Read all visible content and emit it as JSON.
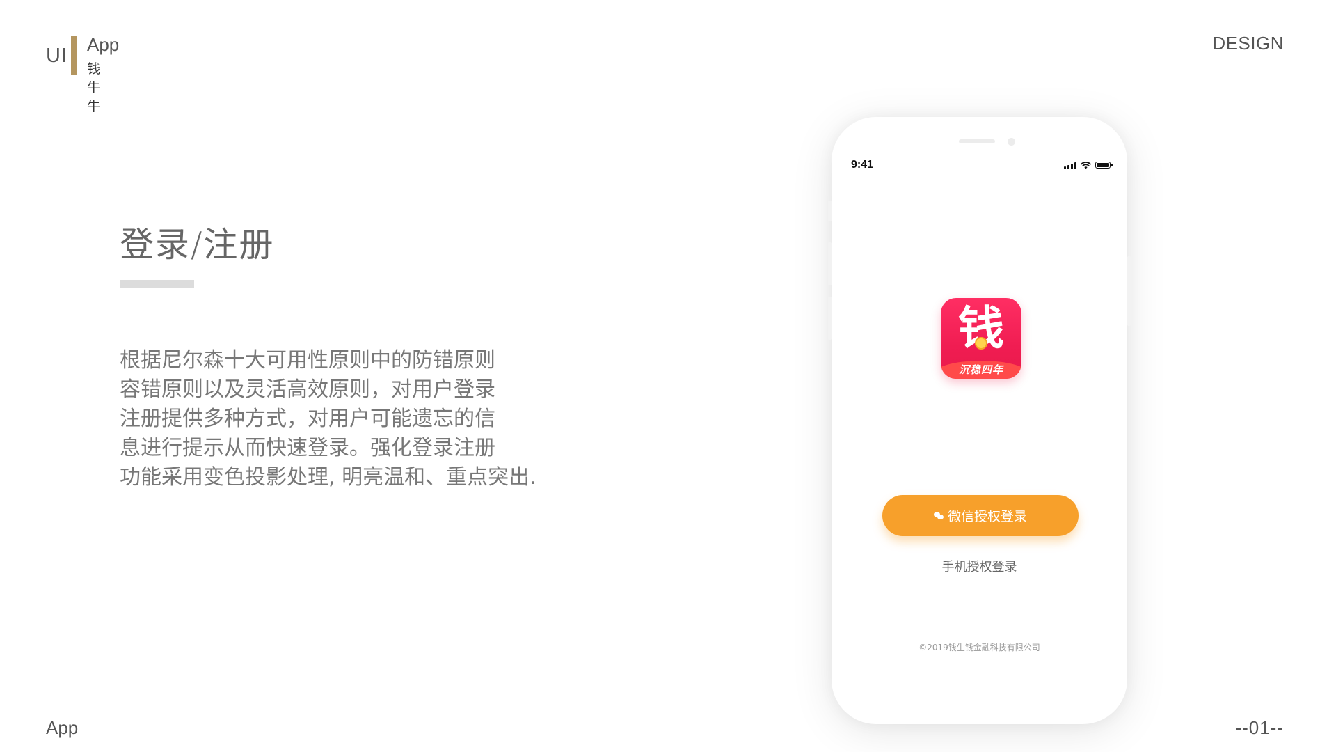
{
  "header": {
    "ui_label": "UI",
    "app_label": "App",
    "app_name": "钱牛牛",
    "design_label": "DESIGN"
  },
  "main": {
    "title": "登录/注册",
    "description_lines": [
      "根据尼尔森十大可用性原则中的防错原则",
      "容错原则以及灵活高效原则，对用户登录",
      "注册提供多种方式，对用户可能遗忘的信",
      "息进行提示从而快速登录。强化登录注册",
      "功能采用变色投影处理, 明亮温和、重点突出."
    ]
  },
  "phone": {
    "status_time": "9:41",
    "app_icon": {
      "glyph": "钱",
      "tagline": "沉稳四年"
    },
    "wechat_login_label": "微信授权登录",
    "phone_login_label": "手机授权登录",
    "copyright": "©2019钱生钱金融科技有限公司",
    "accent_color": "#f7a02b",
    "icon_color": "#f01d52"
  },
  "footer": {
    "app_label": "App",
    "page_number": "--01--"
  },
  "colors": {
    "brand_bar": "#b4965f",
    "rule": "#dcdcdc"
  }
}
